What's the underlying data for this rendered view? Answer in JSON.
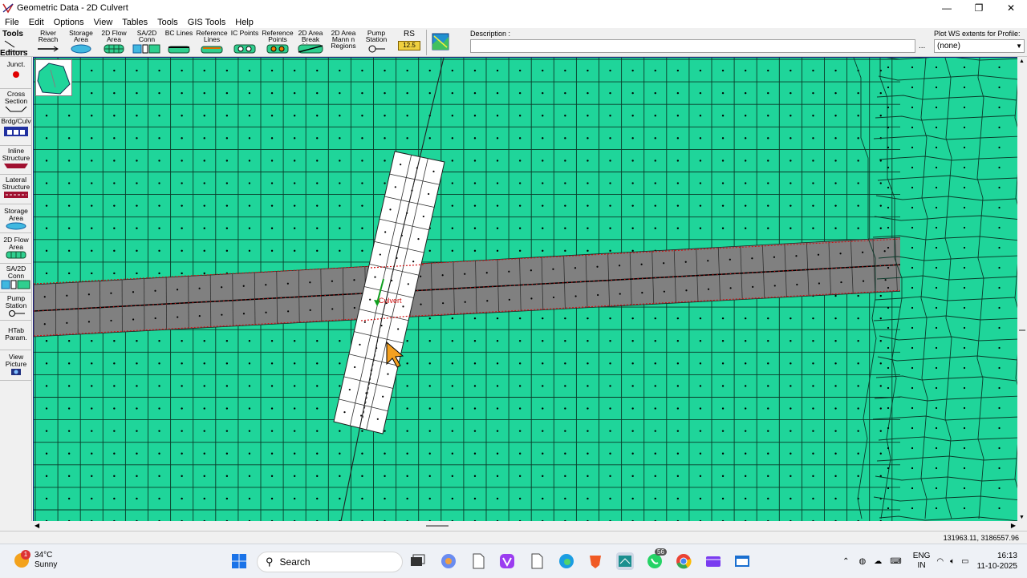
{
  "window": {
    "title": "Geometric Data - 2D Culvert",
    "controls": [
      "—",
      "❐",
      "✕"
    ]
  },
  "menu": [
    "File",
    "Edit",
    "Options",
    "View",
    "Tables",
    "Tools",
    "GIS Tools",
    "Help"
  ],
  "toolbar": {
    "tools_label": "Tools",
    "tools": [
      {
        "label": "River Reach",
        "icon": "river-reach-icon"
      },
      {
        "label": "Storage Area",
        "icon": "storage-area-icon"
      },
      {
        "label": "2D Flow Area",
        "icon": "2d-flow-area-icon"
      },
      {
        "label": "SA/2D Conn",
        "icon": "sa-2d-conn-icon"
      },
      {
        "label": "BC Lines",
        "icon": "bc-lines-icon"
      },
      {
        "label": "Reference Lines",
        "icon": "reference-lines-icon"
      },
      {
        "label": "IC Points",
        "icon": "ic-points-icon"
      },
      {
        "label": "Reference Points",
        "icon": "reference-points-icon"
      },
      {
        "label": "2D Area Break Lines",
        "icon": "break-lines-icon"
      },
      {
        "label": "2D Area Mann n Regions",
        "icon": "mann-n-regions-icon"
      },
      {
        "label": "Pump Station",
        "icon": "pump-station-icon"
      },
      {
        "label": "RS",
        "icon": "rs-icon",
        "badge": "12.5"
      },
      {
        "label": "",
        "icon": "map-layers-icon"
      }
    ],
    "description_label": "Description :",
    "description_value": "",
    "description_more": "...",
    "plot_ws_label": "Plot WS extents for Profile:",
    "plot_ws_value": "(none)"
  },
  "editors": {
    "label": "Editors",
    "items": [
      {
        "label": "Junct.",
        "icon": "junction-icon"
      },
      {
        "label": "Cross Section",
        "icon": "cross-section-icon"
      },
      {
        "label": "Brdg/Culv",
        "icon": "bridge-culvert-icon"
      },
      {
        "label": "Inline Structure",
        "icon": "inline-structure-icon"
      },
      {
        "label": "Lateral Structure",
        "icon": "lateral-structure-icon"
      },
      {
        "label": "Storage Area",
        "icon": "storage-area-icon"
      },
      {
        "label": "2D Flow Area",
        "icon": "2d-flow-area-icon"
      },
      {
        "label": "SA/2D Conn",
        "icon": "sa-2d-conn-icon"
      },
      {
        "label": "Pump Station",
        "icon": "pump-station-icon"
      },
      {
        "label": "HTab Param.",
        "icon": "htab-param-icon"
      },
      {
        "label": "View Picture",
        "icon": "camera-icon"
      }
    ]
  },
  "map": {
    "culvert_label": "Culvert",
    "colors": {
      "mesh": "#1fd59a",
      "road": "#808080",
      "embankment": "#ffffff",
      "refinement": "#cc0000"
    }
  },
  "status": {
    "coordinates": "131963.11, 3186557.96"
  },
  "taskbar": {
    "weather_temp": "34°C",
    "weather_desc": "Sunny",
    "weather_badge": "1",
    "search_placeholder": "Search",
    "whatsapp_badge": "56",
    "lang_1": "ENG",
    "lang_2": "IN",
    "time": "16:13",
    "date": "11-10-2025"
  }
}
